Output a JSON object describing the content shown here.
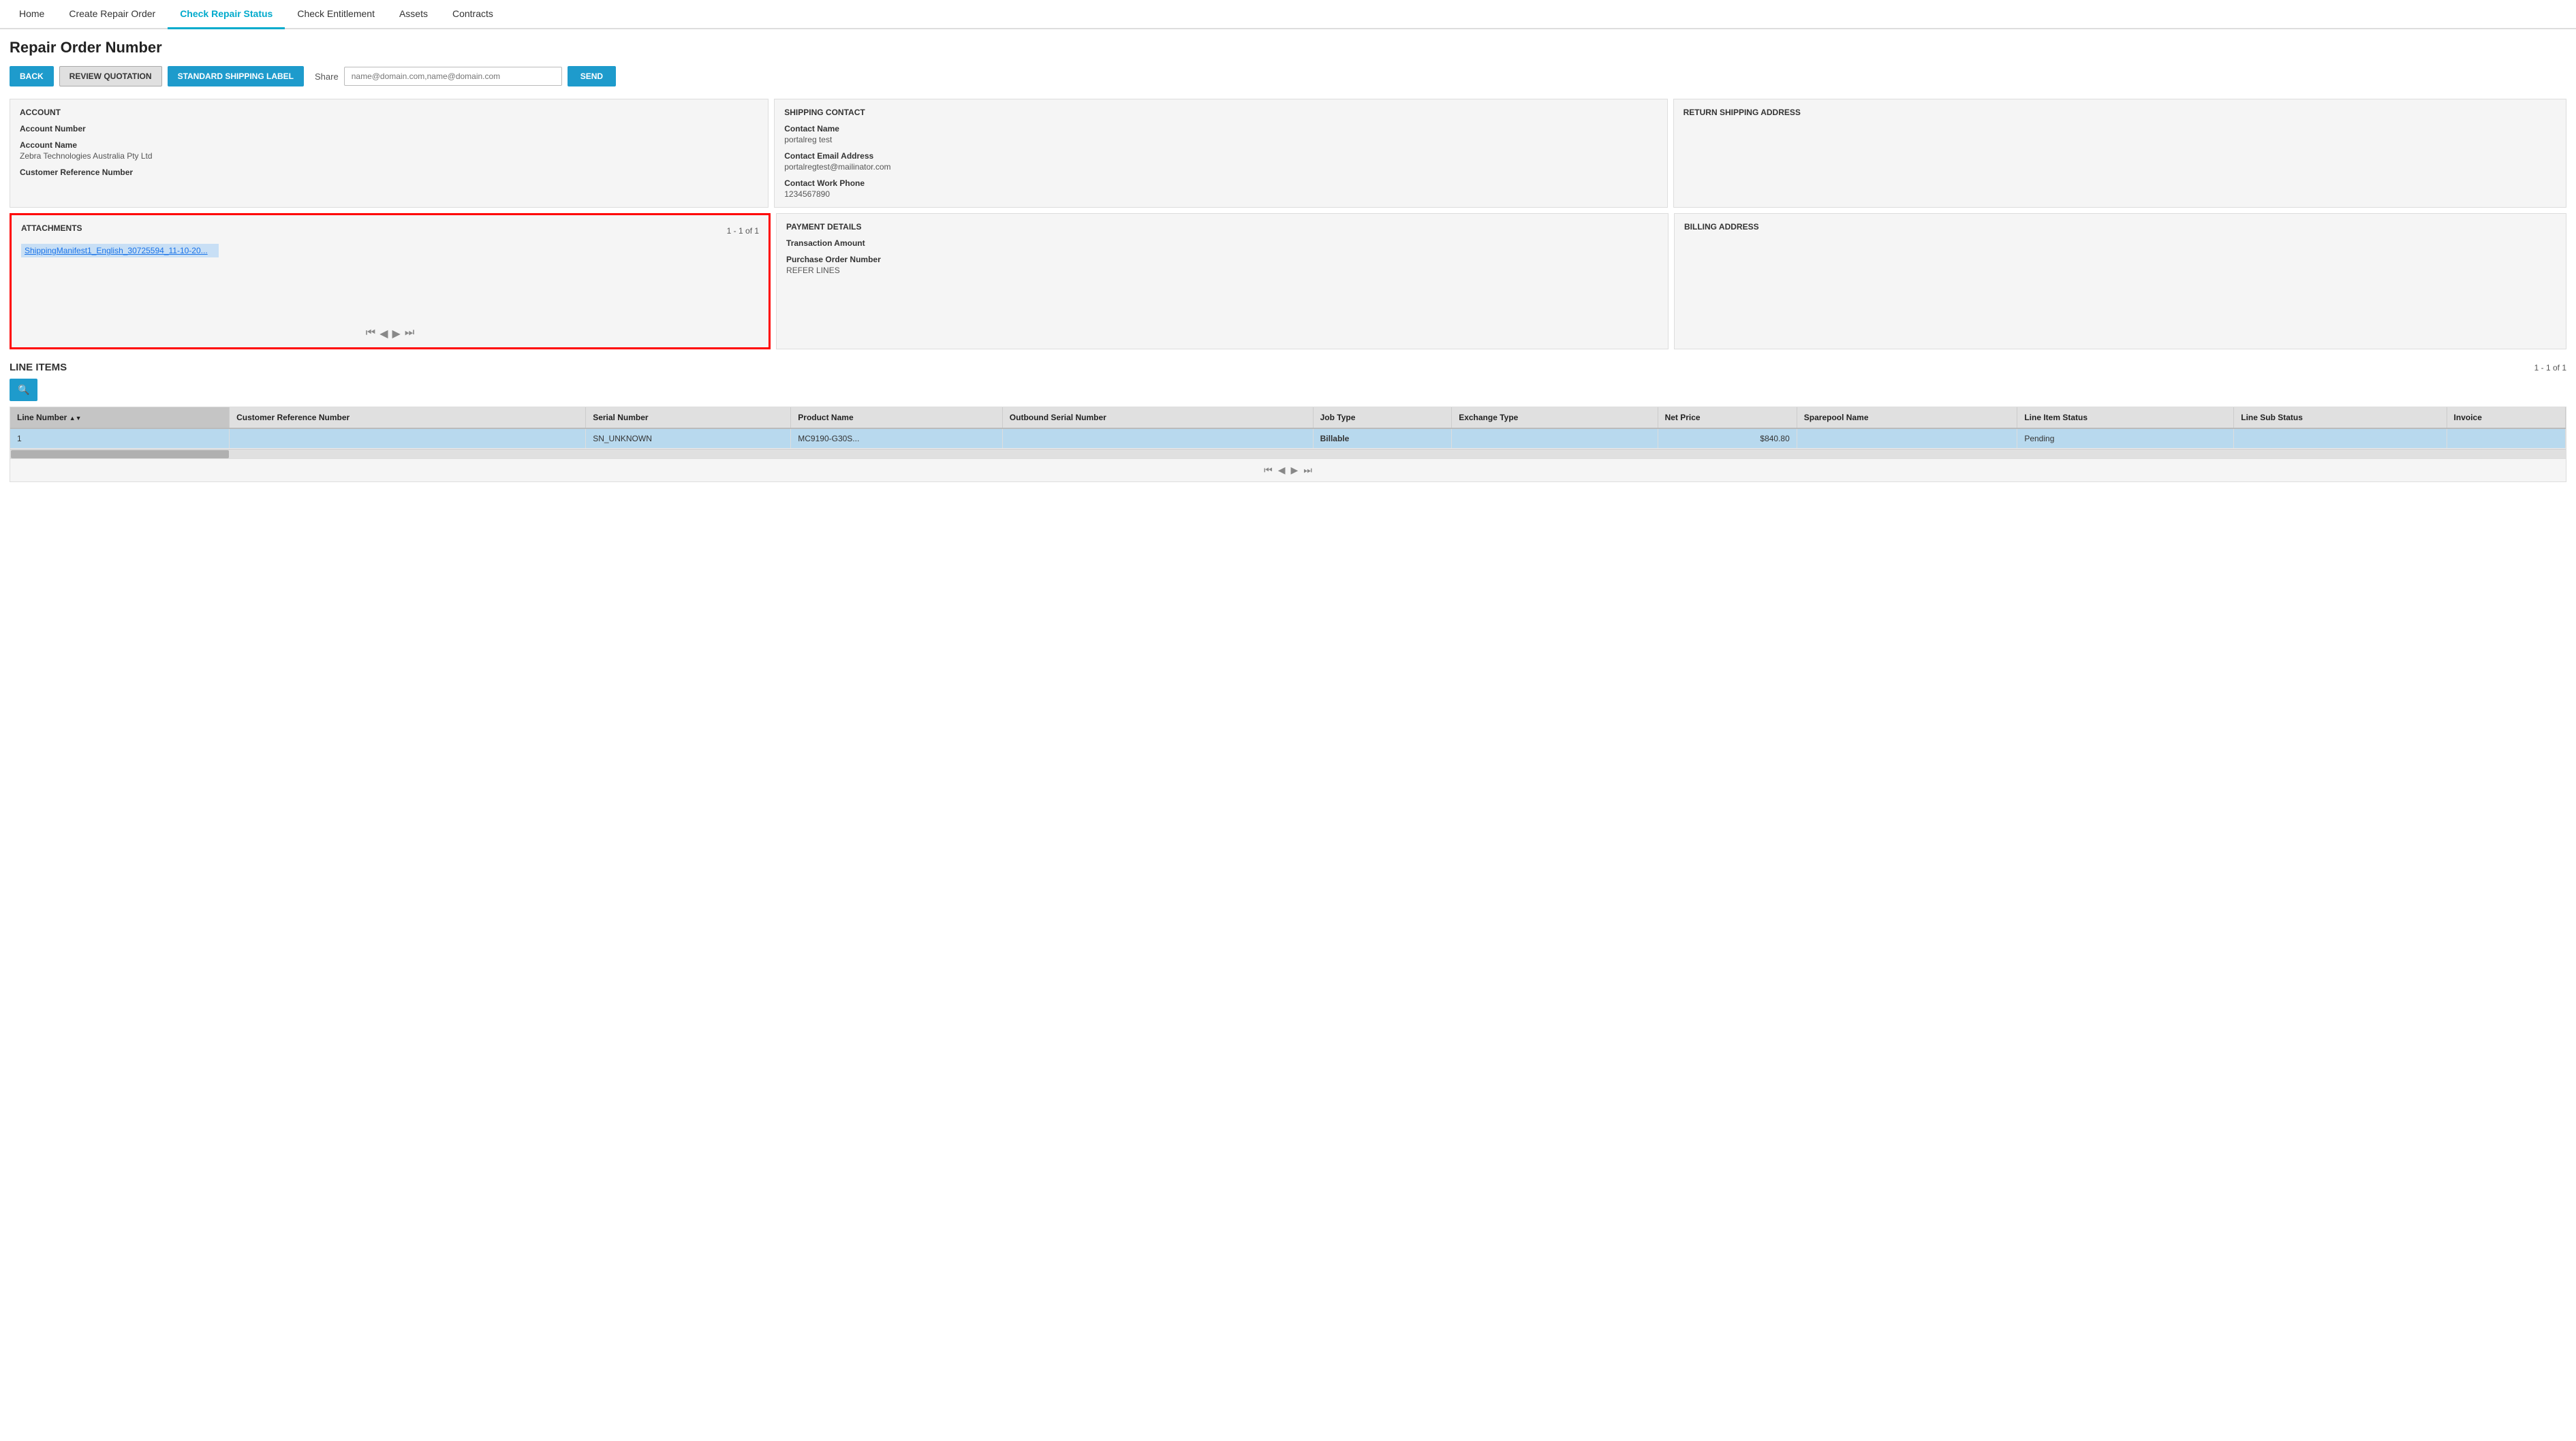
{
  "nav": {
    "items": [
      {
        "label": "Home",
        "active": false
      },
      {
        "label": "Create Repair Order",
        "active": false
      },
      {
        "label": "Check Repair Status",
        "active": true
      },
      {
        "label": "Check Entitlement",
        "active": false
      },
      {
        "label": "Assets",
        "active": false
      },
      {
        "label": "Contracts",
        "active": false
      }
    ]
  },
  "page": {
    "title": "Repair Order Number"
  },
  "toolbar": {
    "back_label": "BACK",
    "review_label": "REVIEW QUOTATION",
    "shipping_label": "STANDARD SHIPPING LABEL",
    "share_label": "Share",
    "share_placeholder": "name@domain.com,name@domain.com",
    "send_label": "SEND"
  },
  "account": {
    "title": "ACCOUNT",
    "fields": [
      {
        "label": "Account Number",
        "value": ""
      },
      {
        "label": "Account Name",
        "value": "Zebra Technologies Australia Pty Ltd"
      },
      {
        "label": "Customer Reference Number",
        "value": ""
      }
    ]
  },
  "shipping_contact": {
    "title": "SHIPPING CONTACT",
    "fields": [
      {
        "label": "Contact Name",
        "value": "portalreg test"
      },
      {
        "label": "Contact Email Address",
        "value": "portalregtest@mailinator.com"
      },
      {
        "label": "Contact Work Phone",
        "value": "1234567890"
      }
    ]
  },
  "return_shipping": {
    "title": "RETURN SHIPPING ADDRESS"
  },
  "attachments": {
    "title": "ATTACHMENTS",
    "count": "1 - 1 of 1",
    "file": "ShippingManifest1_English_30725594_11-10-20..."
  },
  "payment_details": {
    "title": "PAYMENT DETAILS",
    "fields": [
      {
        "label": "Transaction Amount",
        "value": ""
      },
      {
        "label": "Purchase Order Number",
        "value": "REFER LINES"
      }
    ]
  },
  "billing_address": {
    "title": "BILLING ADDRESS"
  },
  "line_items": {
    "title": "LINE ITEMS",
    "count": "1 - 1 of 1",
    "search_icon": "🔍",
    "columns": [
      {
        "label": "Line Number",
        "sortable": true
      },
      {
        "label": "Customer Reference Number"
      },
      {
        "label": "Serial Number"
      },
      {
        "label": "Product Name"
      },
      {
        "label": "Outbound Serial Number"
      },
      {
        "label": "Job Type"
      },
      {
        "label": "Exchange Type"
      },
      {
        "label": "Net Price"
      },
      {
        "label": "Sparepool Name"
      },
      {
        "label": "Line Item Status"
      },
      {
        "label": "Line Sub Status"
      },
      {
        "label": "Invoice"
      }
    ],
    "rows": [
      {
        "line_number": "1",
        "customer_ref": "",
        "serial_number": "SN_UNKNOWN",
        "product_name": "MC9190-G30S...",
        "outbound_serial": "",
        "job_type": "Billable",
        "exchange_type": "",
        "net_price": "$840.80",
        "sparepool": "",
        "status": "Pending",
        "sub_status": "",
        "invoice": ""
      }
    ]
  }
}
